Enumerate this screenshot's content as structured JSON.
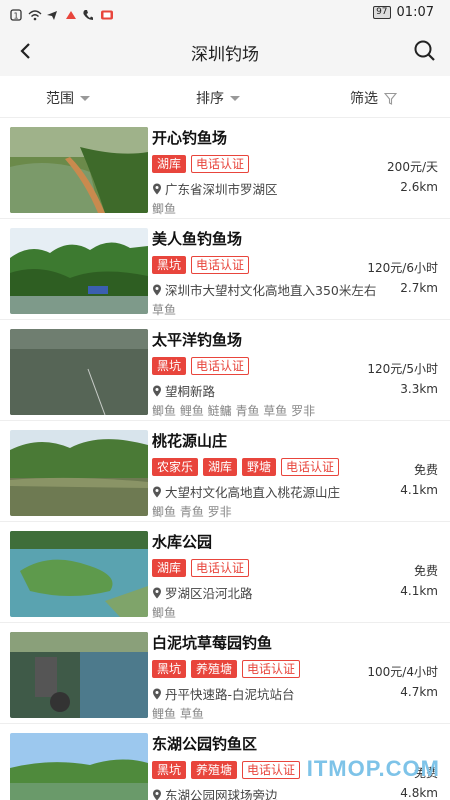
{
  "status_bar": {
    "battery": "97",
    "time": "01:07"
  },
  "header": {
    "title": "深圳钓场"
  },
  "filters": {
    "range": "范围",
    "sort": "排序",
    "filter": "筛选"
  },
  "items": [
    {
      "name": "开心钓鱼场",
      "tags": [
        "湖库"
      ],
      "outline_tags": [
        "电话认证"
      ],
      "price": "200元/天",
      "address": "广东省深圳市罗湖区",
      "distance": "2.6km",
      "fish": "鲫鱼"
    },
    {
      "name": "美人鱼钓鱼场",
      "tags": [
        "黑坑"
      ],
      "outline_tags": [
        "电话认证"
      ],
      "price": "120元/6小时",
      "address": "深圳市大望村文化高地直入350米左右",
      "distance": "2.7km",
      "fish": "草鱼"
    },
    {
      "name": "太平洋钓鱼场",
      "tags": [
        "黑坑"
      ],
      "outline_tags": [
        "电话认证"
      ],
      "price": "120元/5小时",
      "address": "望桐新路",
      "distance": "3.3km",
      "fish": "鲫鱼 鲤鱼 鲢鳙 青鱼 草鱼 罗非"
    },
    {
      "name": "桃花源山庄",
      "tags": [
        "农家乐",
        "湖库",
        "野塘"
      ],
      "outline_tags": [
        "电话认证"
      ],
      "price": "免费",
      "address": "大望村文化高地直入桃花源山庄",
      "distance": "4.1km",
      "fish": "鲫鱼 青鱼 罗非"
    },
    {
      "name": "水库公园",
      "tags": [
        "湖库"
      ],
      "outline_tags": [
        "电话认证"
      ],
      "price": "免费",
      "address": "罗湖区沿河北路",
      "distance": "4.1km",
      "fish": "鲫鱼"
    },
    {
      "name": "白泥坑草莓园钓鱼",
      "tags": [
        "黑坑",
        "养殖塘"
      ],
      "outline_tags": [
        "电话认证"
      ],
      "price": "100元/4小时",
      "address": "丹平快速路-白泥坑站台",
      "distance": "4.7km",
      "fish": "鲤鱼 草鱼"
    },
    {
      "name": "东湖公园钓鱼区",
      "tags": [
        "黑坑",
        "养殖塘"
      ],
      "outline_tags": [
        "电话认证"
      ],
      "price": "免费",
      "address": "东湖公园网球场旁边",
      "distance": "4.8km",
      "fish": ""
    }
  ],
  "watermark": "ITMOP.COM",
  "colors": {
    "accent": "#e8453c",
    "header_bg": "#f5f5f5"
  }
}
